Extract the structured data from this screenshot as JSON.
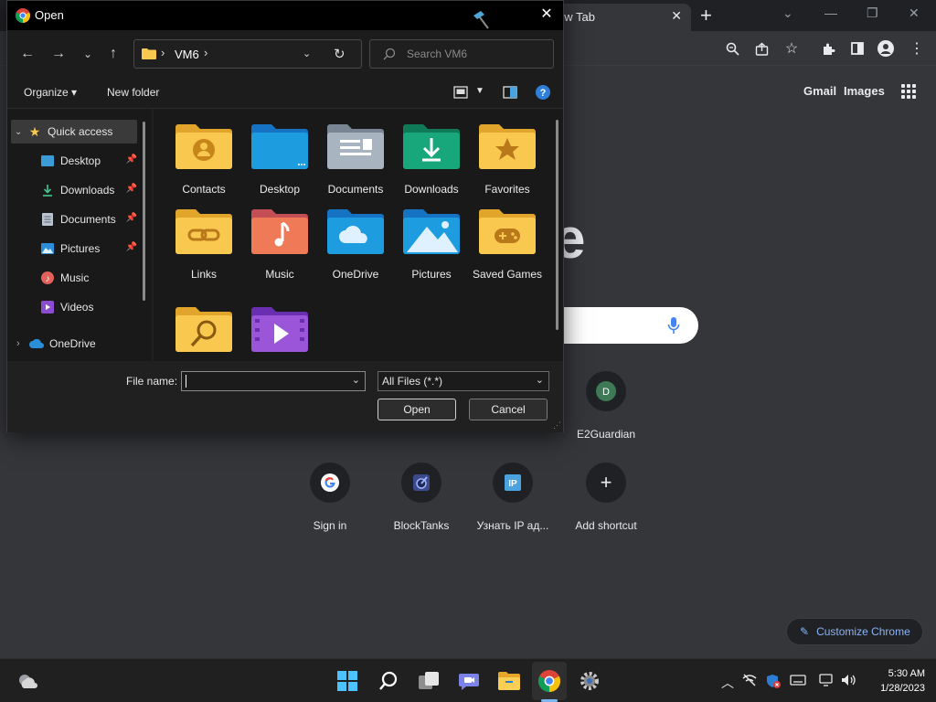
{
  "chrome": {
    "tab_title": "ew Tab",
    "gmail": "Gmail",
    "images": "Images",
    "logo_fragment": "e",
    "shortcuts_row1": [
      {
        "label": "E2Guardian",
        "letter": "D"
      }
    ],
    "shortcuts_row2": [
      {
        "label": "Sign in"
      },
      {
        "label": "BlockTanks"
      },
      {
        "label": "Узнать IP ад..."
      },
      {
        "label": "Add shortcut"
      }
    ],
    "customize": "Customize Chrome"
  },
  "dialog": {
    "title": "Open",
    "path_folder": "VM6",
    "search_placeholder": "Search VM6",
    "organize": "Organize",
    "new_folder": "New folder",
    "nav": [
      {
        "label": "Quick access",
        "icon": "star-icon"
      },
      {
        "label": "Desktop",
        "icon": "desktop-icon",
        "pinned": true
      },
      {
        "label": "Downloads",
        "icon": "download-icon",
        "pinned": true
      },
      {
        "label": "Documents",
        "icon": "document-icon",
        "pinned": true
      },
      {
        "label": "Pictures",
        "icon": "picture-icon",
        "pinned": true
      },
      {
        "label": "Music",
        "icon": "music-icon"
      },
      {
        "label": "Videos",
        "icon": "video-icon"
      },
      {
        "label": "OneDrive",
        "icon": "cloud-icon"
      }
    ],
    "files": [
      {
        "label": "Contacts"
      },
      {
        "label": "Desktop"
      },
      {
        "label": "Documents"
      },
      {
        "label": "Downloads"
      },
      {
        "label": "Favorites"
      },
      {
        "label": "Links"
      },
      {
        "label": "Music"
      },
      {
        "label": "OneDrive"
      },
      {
        "label": "Pictures"
      },
      {
        "label": "Saved Games"
      },
      {
        "label": ""
      },
      {
        "label": ""
      }
    ],
    "file_name_label": "File name:",
    "file_name_value": "",
    "filter": "All Files (*.*)",
    "open_btn": "Open",
    "cancel_btn": "Cancel"
  },
  "taskbar": {
    "time": "5:30 AM",
    "date": "1/28/2023"
  },
  "colors": {
    "accent": "#7bb6f0",
    "folder_yellow": "#f8c94e",
    "chrome_blue": "#8ab4f8"
  }
}
